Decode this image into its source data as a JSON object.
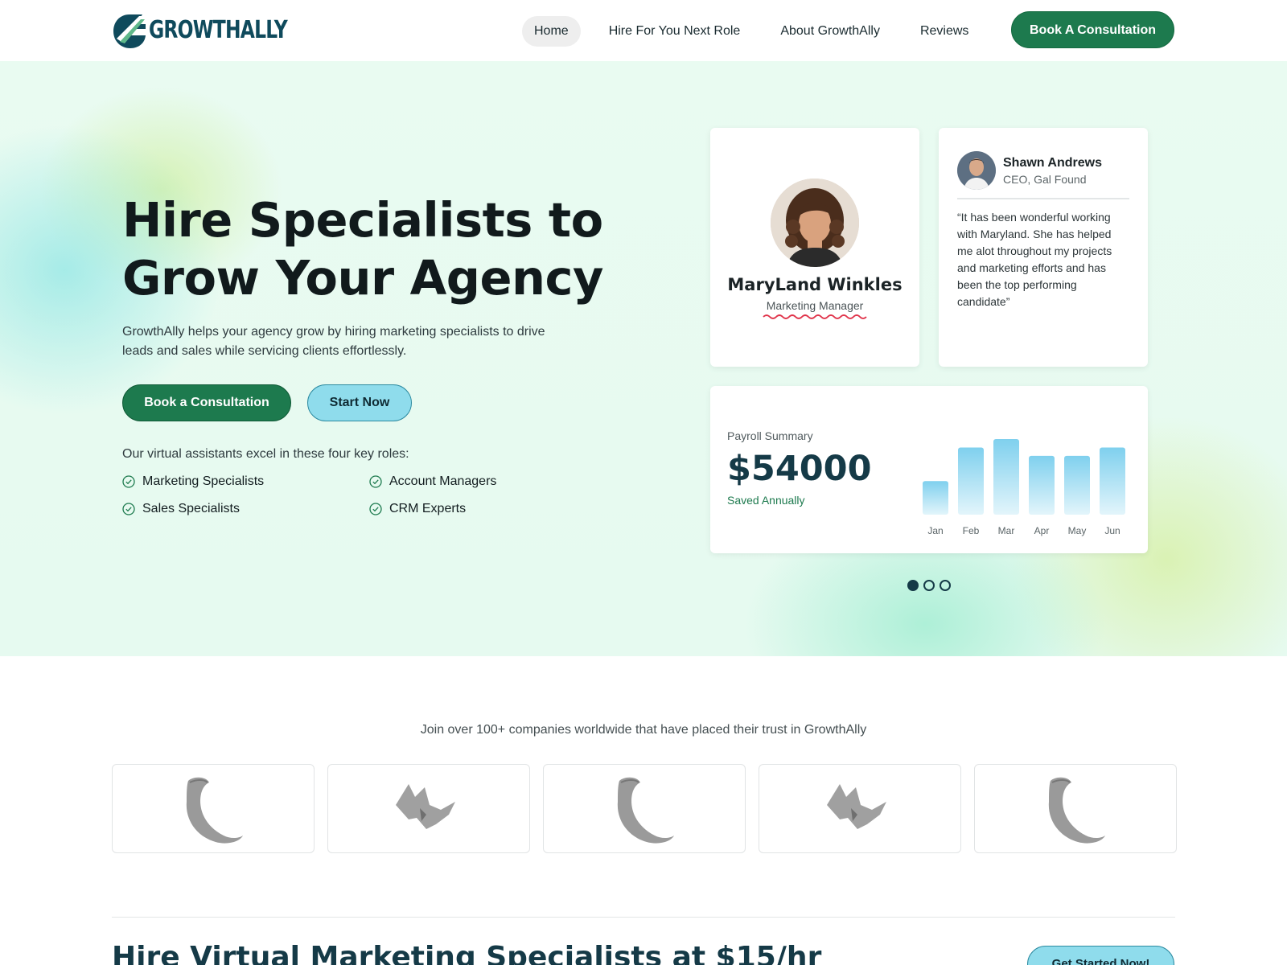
{
  "brand": {
    "name": "GROWTHALLY",
    "logo_icon": "growthally-g-icon"
  },
  "nav": {
    "links": [
      "Home",
      "Hire For You Next Role",
      "About GrowthAlly",
      "Reviews"
    ],
    "active": "Home",
    "cta": "Book A Consultation",
    "colors": {
      "primary": "#1d7a4e",
      "accent": "#8fdcec",
      "dark": "#153a47"
    }
  },
  "hero": {
    "title_line1": "Hire Specialists to",
    "title_line2": "Grow Your Agency",
    "description": "GrowthAlly helps your agency grow by hiring marketing specialists to drive leads and sales while servicing clients effortlessly.",
    "primary_button": "Book a Consultation",
    "secondary_button": "Start Now",
    "roles_intro": "Our virtual assistants excel in these four key roles:",
    "roles": [
      "Marketing Specialists",
      "Account Managers",
      "Sales Specialists",
      "CRM Experts"
    ]
  },
  "profile_card": {
    "name": "MaryLand Winkles",
    "role": "Marketing Manager"
  },
  "quote_card": {
    "name": "Shawn Andrews",
    "title": "CEO, Gal Found",
    "quote": "“It has been wonderful working with Maryland. She has helped me alot throughout my projects and marketing efforts and has been the top performing candidate”"
  },
  "payroll_card": {
    "label": "Payroll Summary",
    "amount": "$54000",
    "sub": "Saved Annually",
    "chart_data": {
      "type": "bar",
      "categories": [
        "Jan",
        "Feb",
        "Mar",
        "Apr",
        "May",
        "Jun"
      ],
      "values": [
        4,
        8,
        9,
        7,
        7,
        8
      ]
    }
  },
  "carousel": {
    "count": 3,
    "active_index": 0
  },
  "trust": {
    "text": "Join over 100+ companies worldwide that have placed their trust in GrowthAlly",
    "logos": [
      "horn-logo-icon",
      "rhino-logo-icon",
      "horn-logo-icon",
      "rhino-logo-icon",
      "horn-logo-icon"
    ]
  },
  "section": {
    "title": "Hire Virtual Marketing Specialists at $15/hr",
    "cta": "Get Started Now!"
  }
}
